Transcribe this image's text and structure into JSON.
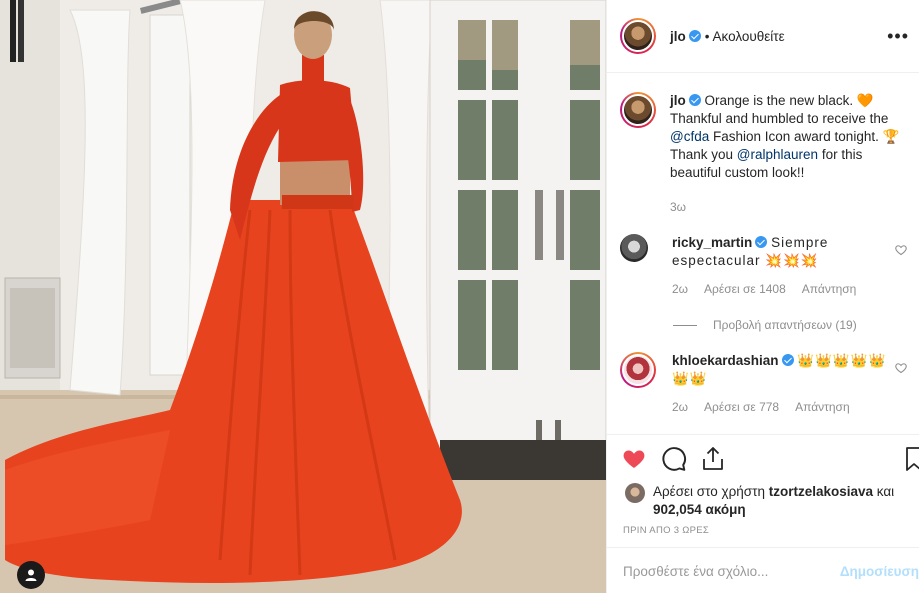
{
  "post": {
    "image_alt": "Woman in orange crop top and long orange gown by French doors",
    "tag_icon": "person-tag-icon"
  },
  "header": {
    "username": "jlo",
    "follow_state": "• Ακολουθείτε",
    "more": "•••"
  },
  "caption": {
    "username": "jlo",
    "text_1": "Orange is the new black. 🧡",
    "text_2": "Thankful and humbled to receive the",
    "mention_1": "@cfda",
    "text_3": " Fashion Icon award tonight.",
    "text_4": "🏆Thank you ",
    "mention_2": "@ralphlauren",
    "text_5": " for this beautiful custom look!!",
    "age": "3ω"
  },
  "comments": [
    {
      "username": "ricky_martin",
      "text": "Siempre espectacular 💥💥💥",
      "age": "2ω",
      "likes": "Αρέσει σε 1408",
      "reply": "Απάντηση"
    },
    {
      "username": "khloekardashian",
      "text": "👑👑👑👑👑👑👑",
      "age": "2ω",
      "likes": "Αρέσει σε 778",
      "reply": "Απάντηση"
    }
  ],
  "view_replies": "Προβολή απαντήσεων (19)",
  "likes": {
    "prefix": "Αρέσει στο χρήστη ",
    "user": "tzortzelakosiava",
    "middle": " και ",
    "count": "902,054 ακόμη"
  },
  "timestamp": "ΠΡΙΝ ΑΠΟ 3 ΩΡΕΣ",
  "add_comment": {
    "placeholder": "Προσθέστε ένα σχόλιο...",
    "post_label": "Δημοσίευση"
  },
  "colors": {
    "like_red": "#ed4956",
    "verified_blue": "#3897f0",
    "mention": "#003569",
    "gown_orange": "#e8431f"
  }
}
